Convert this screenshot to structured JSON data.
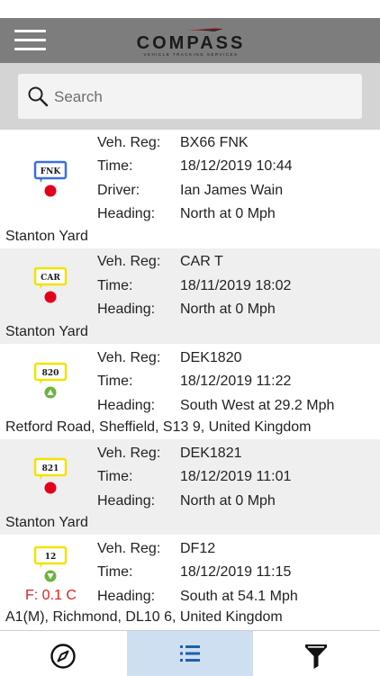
{
  "header": {
    "logo_text": "COMPASS",
    "logo_subtext": "VEHICLE TRACKING SERVICES",
    "menu_icon": "hamburger-menu-icon"
  },
  "search": {
    "placeholder": "Search",
    "icon": "search-icon"
  },
  "labels": {
    "reg": "Veh. Reg:",
    "time": "Time:",
    "driver": "Driver:",
    "heading": "Heading:"
  },
  "vehicles": [
    {
      "badge": "FNK",
      "badge_color": "#3a6fd8",
      "status": "stopped",
      "status_color": "#e3001b",
      "reg": "BX66 FNK",
      "time": "18/12/2019 10:44",
      "driver": "Ian James Wain",
      "heading": "North at 0 Mph",
      "address": "Stanton Yard"
    },
    {
      "badge": "CAR",
      "badge_color": "#f2e200",
      "status": "stopped",
      "status_color": "#e3001b",
      "reg": "CAR T",
      "time": "18/11/2019 18:02",
      "heading": "North at 0 Mph",
      "address": "Stanton Yard"
    },
    {
      "badge": "820",
      "badge_color": "#f2e200",
      "status": "moving",
      "status_color": "#6cb33f",
      "reg": "DEK1820",
      "time": "18/12/2019 11:22",
      "heading": "South West at 29.2 Mph",
      "address": "Retford Road, Sheffield, S13 9, United Kingdom"
    },
    {
      "badge": "821",
      "badge_color": "#f2e200",
      "status": "stopped",
      "status_color": "#e3001b",
      "reg": "DEK1821",
      "time": "18/12/2019 11:01",
      "heading": "North at 0 Mph",
      "address": "Stanton Yard"
    },
    {
      "badge": "12",
      "badge_color": "#f2e200",
      "status": "moving",
      "status_color": "#6cb33f",
      "reg": "DF12",
      "time": "18/12/2019 11:15",
      "heading": "South at 54.1 Mph",
      "fuel": "F: 0.1 C",
      "address": "A1(M), Richmond, DL10 6, United Kingdom"
    }
  ],
  "tabs": [
    {
      "name": "map",
      "icon": "compass-icon",
      "active": false
    },
    {
      "name": "list",
      "icon": "list-icon",
      "active": true
    },
    {
      "name": "filter",
      "icon": "filter-icon",
      "active": false
    }
  ],
  "colors": {
    "header_bg": "#7d7d7d",
    "search_bg": "#d4d4d4",
    "alt_row": "#efefef",
    "active_tab": "#cddff0",
    "accent": "#1f5fa8"
  }
}
